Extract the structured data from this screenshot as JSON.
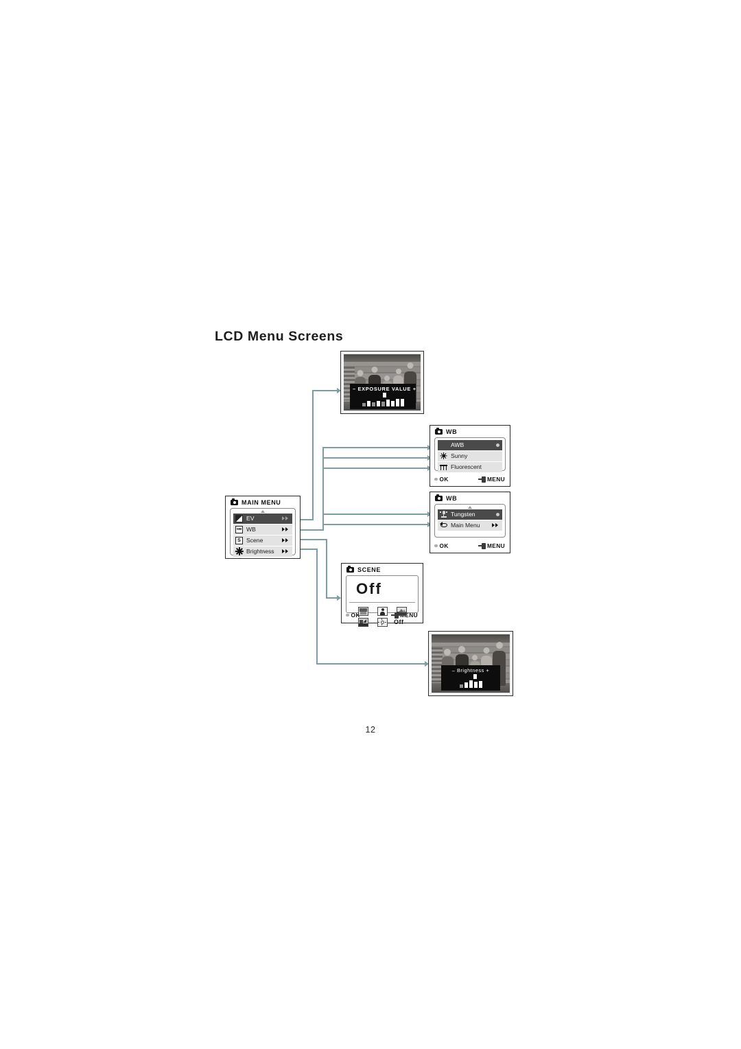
{
  "document": {
    "heading": "LCD Menu Screens",
    "page_number": "12"
  },
  "accent_color": "#7b9ea6",
  "screens": {
    "exposure_value": {
      "name": "exposure-value-screen",
      "overlay_minus": "–",
      "overlay_title": "EXPOSURE VALUE",
      "overlay_plus": "+",
      "marker_position_percent": 50,
      "bar_values": [
        38,
        55,
        42,
        62,
        48,
        72,
        58,
        85,
        78
      ]
    },
    "main_menu": {
      "header_title": "MAIN MENU",
      "header_icon": "camera-icon",
      "rows": [
        {
          "label": "EV",
          "icon": "ev-icon",
          "selected": true,
          "arrow": "double-right-arrow"
        },
        {
          "label": "WB",
          "icon": "wb-icon",
          "selected": false,
          "arrow": "double-right-arrow"
        },
        {
          "label": "Scene",
          "icon": "scene-icon",
          "selected": false,
          "arrow": "double-right-arrow"
        },
        {
          "label": "Brightness",
          "icon": "brightness-star-icon",
          "selected": false,
          "arrow": "double-right-arrow"
        }
      ]
    },
    "wb_page_one": {
      "header_title": "WB",
      "header_icon": "camera-icon",
      "rows": [
        {
          "label": "AWB",
          "icon": "none",
          "selected": true,
          "marker": "selected-dot"
        },
        {
          "label": "Sunny",
          "icon": "sun-icon",
          "selected": false,
          "marker": "none"
        },
        {
          "label": "Fluorescent",
          "icon": "fluorescent-icon",
          "selected": false,
          "marker": "none"
        }
      ],
      "footer": {
        "ok_label": "OK",
        "menu_label": "MENU"
      }
    },
    "wb_page_two": {
      "header_title": "WB",
      "header_icon": "camera-icon",
      "rows": [
        {
          "label": "Tungsten",
          "icon": "tungsten-icon",
          "selected": true,
          "marker": "selected-dot"
        },
        {
          "label": "Main Menu",
          "icon": "return-arrow-icon",
          "selected": false,
          "marker": "double-right-arrow"
        }
      ],
      "footer": {
        "ok_label": "OK",
        "menu_label": "MENU"
      }
    },
    "scene": {
      "header_title": "SCENE",
      "header_icon": "camera-icon",
      "current_value": "Off",
      "mode_icons": [
        "night-scene-icon",
        "portrait-icon",
        "landscape-icon",
        "sports-icon",
        "backlight-icon"
      ],
      "off_label": "Off",
      "footer": {
        "ok_label": "OK",
        "menu_label": "MENU"
      }
    },
    "brightness": {
      "name": "brightness-screen",
      "overlay_minus": "–",
      "overlay_title": "Brightness",
      "overlay_plus": "+",
      "marker_position_percent": 55,
      "bar_values": [
        45,
        62,
        92,
        70,
        80
      ]
    }
  }
}
